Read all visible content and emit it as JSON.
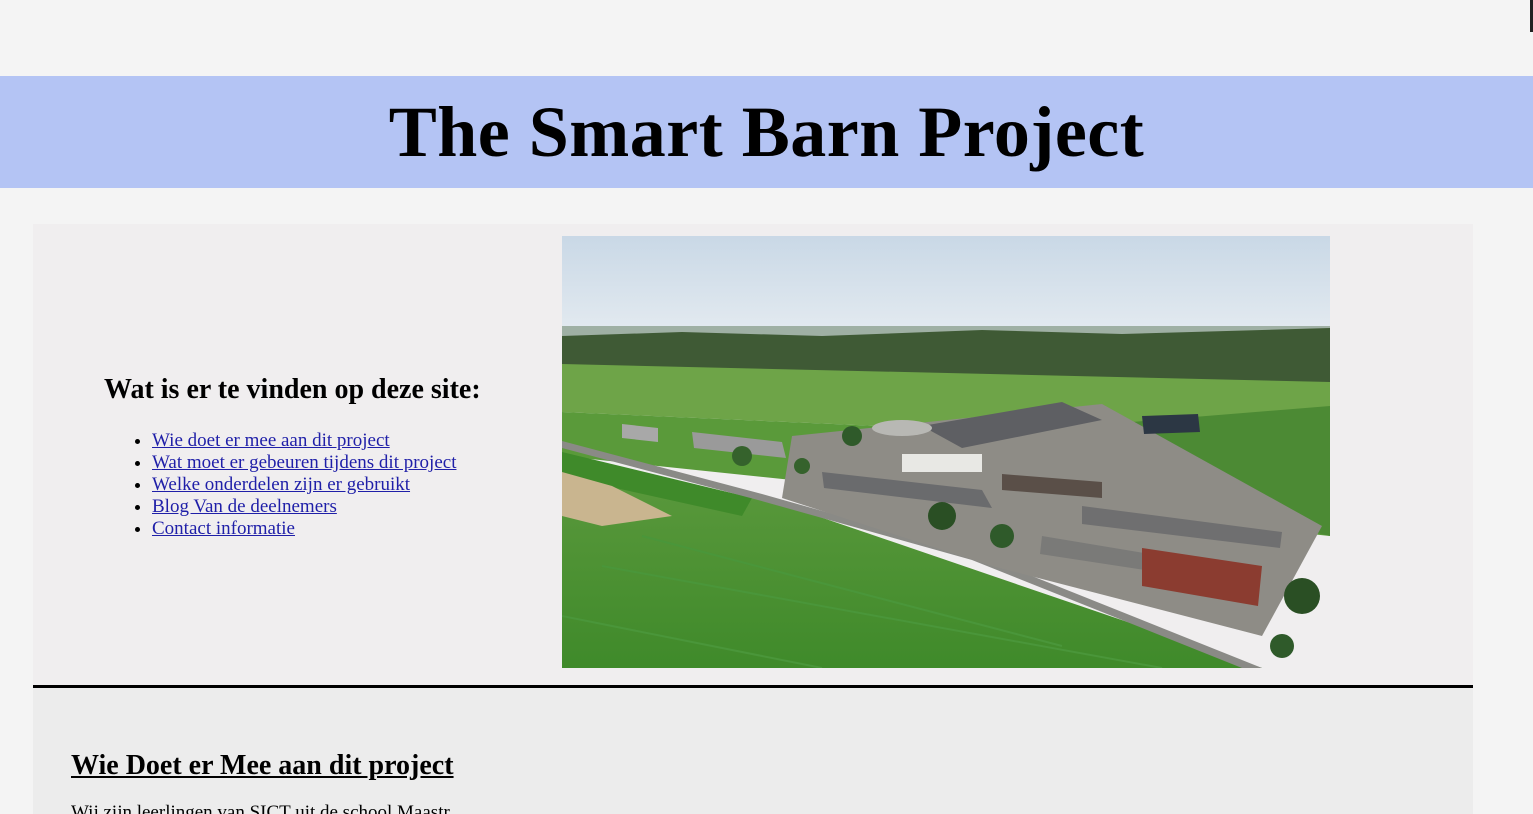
{
  "header": {
    "title": "The Smart Barn Project"
  },
  "intro": {
    "heading": "Wat is er te vinden op deze site:",
    "links": [
      "Wie doet er mee aan dit project",
      "Wat moet er gebeuren tijdens dit project",
      "Welke onderdelen zijn er gebruikt",
      "Blog Van de deelnemers",
      "Contact informatie"
    ]
  },
  "members": {
    "heading": "Wie Doet er Mee aan dit project",
    "paragraph": "Wij zijn leerlingen van SICT uit de school Maastr..."
  },
  "colors": {
    "header_bg": "#b4c4f4",
    "page_bg": "#f4f4f4",
    "section_bg": "#f0eeef",
    "link": "#1f1fa8"
  },
  "icons": {
    "hero_image": "aerial-farm-photo"
  }
}
